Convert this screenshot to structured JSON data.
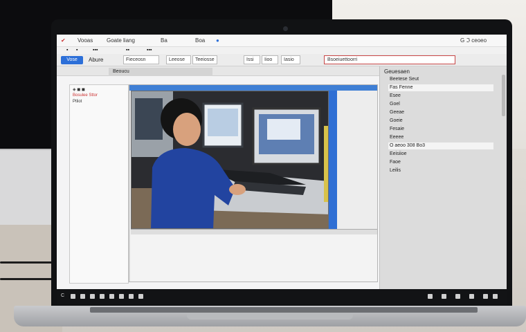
{
  "window": {
    "menu": [
      "Vooas",
      "Goate liang",
      "Ba",
      "Boa"
    ],
    "right_title": "G ℑ ceoeo"
  },
  "ribbon": {
    "primary": "Vose",
    "app_name": "Abure",
    "boxes": [
      "Fieceosn",
      "Leeose",
      "Teeiosse"
    ],
    "small_boxes": [
      "Issi",
      "Iioo",
      "Iasio"
    ],
    "search": "Bsoeiuettoorri"
  },
  "subbar": {
    "tab_label": "Beoucu"
  },
  "left_panel": {
    "rows": [
      "Bosulee Sttor",
      "Ptliot"
    ]
  },
  "right_panel": {
    "header": "Geuesaen",
    "items": [
      "Beetese Seut",
      "Fas Fenne",
      "Esee",
      "Goel",
      "Geeae",
      "Goeie",
      "Fesaie",
      "Eeeee",
      "O aeoo 308 Bo3",
      "Eeisiioe",
      "Faoe",
      "Leilis"
    ],
    "selected": [
      1,
      8
    ]
  },
  "colors": {
    "accent": "#2c6fd8",
    "search_border": "#c74545",
    "taskbar": "#121315"
  }
}
